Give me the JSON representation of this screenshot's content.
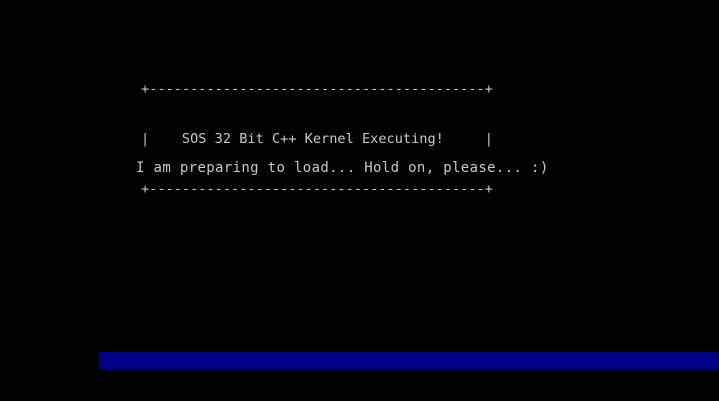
{
  "banner": {
    "top_border": "+-----------------------------------------+",
    "title_line": "|    SOS 32 Bit C++ Kernel Executing!     |",
    "bottom_border": "+-----------------------------------------+"
  },
  "message": "I am preparing to load... Hold on, please... :)",
  "progress": {
    "fraction": 1.0,
    "color": "#000088"
  },
  "colors": {
    "background": "#000000",
    "text": "#c8c8c8"
  }
}
